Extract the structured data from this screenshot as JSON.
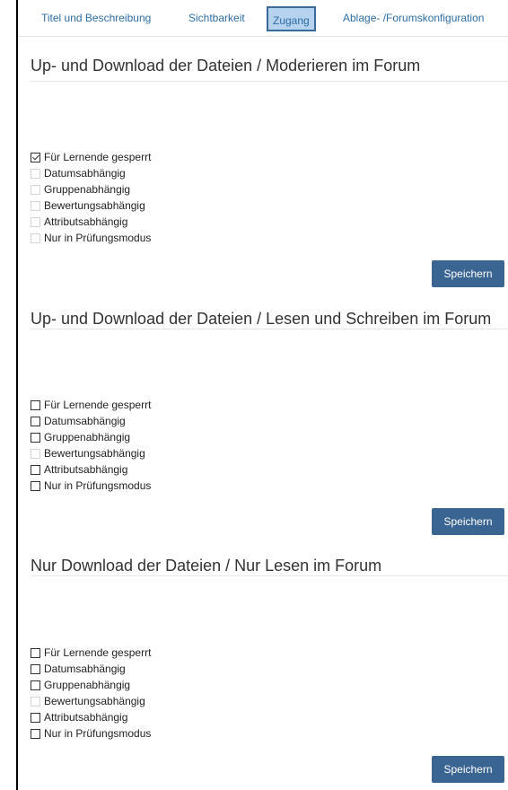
{
  "tabs": [
    {
      "label": "Titel und Beschreibung",
      "active": false
    },
    {
      "label": "Sichtbarkeit",
      "active": false
    },
    {
      "label": "Zugang",
      "active": true
    },
    {
      "label": "Ablage- /Forumskonfiguration",
      "active": false
    }
  ],
  "sections": [
    {
      "title": "Up- und Download der Dateien / Moderieren im Forum",
      "options": [
        {
          "label": "Für Lernende gesperrt",
          "checked": true,
          "disabled": false
        },
        {
          "label": "Datumsabhängig",
          "checked": false,
          "disabled": true
        },
        {
          "label": "Gruppenabhängig",
          "checked": false,
          "disabled": true
        },
        {
          "label": "Bewertungsabhängig",
          "checked": false,
          "disabled": true
        },
        {
          "label": "Attributsabhängig",
          "checked": false,
          "disabled": true
        },
        {
          "label": "Nur in Prüfungsmodus",
          "checked": false,
          "disabled": true
        }
      ],
      "save_label": "Speichern"
    },
    {
      "title": "Up- und Download der Dateien / Lesen und Schreiben im Forum",
      "options": [
        {
          "label": "Für Lernende gesperrt",
          "checked": false,
          "disabled": false
        },
        {
          "label": "Datumsabhängig",
          "checked": false,
          "disabled": false
        },
        {
          "label": "Gruppenabhängig",
          "checked": false,
          "disabled": false
        },
        {
          "label": "Bewertungsabhängig",
          "checked": false,
          "disabled": true
        },
        {
          "label": "Attributsabhängig",
          "checked": false,
          "disabled": false
        },
        {
          "label": "Nur in Prüfungsmodus",
          "checked": false,
          "disabled": false
        }
      ],
      "save_label": "Speichern"
    },
    {
      "title": "Nur Download der Dateien / Nur Lesen im Forum",
      "options": [
        {
          "label": "Für Lernende gesperrt",
          "checked": false,
          "disabled": false
        },
        {
          "label": "Datumsabhängig",
          "checked": false,
          "disabled": false
        },
        {
          "label": "Gruppenabhängig",
          "checked": false,
          "disabled": false
        },
        {
          "label": "Bewertungsabhängig",
          "checked": false,
          "disabled": true
        },
        {
          "label": "Attributsabhängig",
          "checked": false,
          "disabled": false
        },
        {
          "label": "Nur in Prüfungsmodus",
          "checked": false,
          "disabled": false
        }
      ],
      "save_label": "Speichern"
    }
  ]
}
